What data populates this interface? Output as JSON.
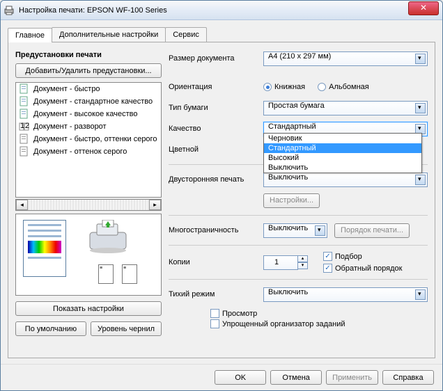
{
  "window": {
    "title": "Настройка печати: EPSON WF-100 Series"
  },
  "tabs": [
    "Главное",
    "Дополнительные настройки",
    "Сервис"
  ],
  "presets": {
    "title": "Предустановки печати",
    "add_remove": "Добавить/Удалить предустановки...",
    "items": [
      "Документ - быстро",
      "Документ - стандартное качество",
      "Документ - высокое качество",
      "Документ - разворот",
      "Документ - быстро, оттенки серого",
      "Документ - оттенок серого"
    ],
    "show_settings": "Показать настройки",
    "defaults": "По умолчанию",
    "ink_levels": "Уровень чернил"
  },
  "labels": {
    "doc_size": "Размер документа",
    "orientation": "Ориентация",
    "portrait": "Книжная",
    "landscape": "Альбомная",
    "paper_type": "Тип бумаги",
    "quality": "Качество",
    "color": "Цветной",
    "duplex": "Двусторонняя печать",
    "duplex_settings": "Настройки...",
    "multipage": "Многостраничность",
    "page_order": "Порядок печати...",
    "copies": "Копии",
    "collate": "Подбор",
    "reverse": "Обратный порядок",
    "quiet": "Тихий режим",
    "preview": "Просмотр",
    "job_arranger": "Упрощенный организатор заданий"
  },
  "values": {
    "doc_size": "A4 (210 x 297 мм)",
    "paper_type": "Простая бумага",
    "quality": "Стандартный",
    "duplex": "Выключить",
    "multipage": "Выключить",
    "copies": "1",
    "quiet": "Выключить"
  },
  "quality_options": [
    "Черновик",
    "Стандартный",
    "Высокий",
    "Выключить"
  ],
  "footer": {
    "ok": "OK",
    "cancel": "Отмена",
    "apply": "Применить",
    "help": "Справка"
  }
}
